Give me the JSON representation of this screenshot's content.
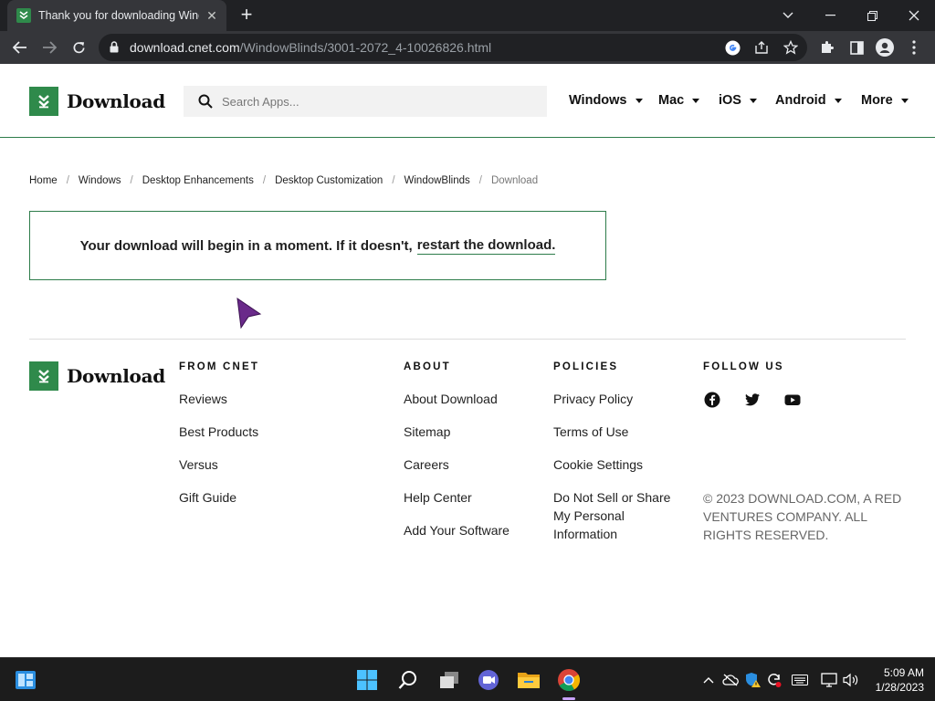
{
  "browser": {
    "tab_title": "Thank you for downloading WindowBlinds",
    "url_host": "download.cnet.com",
    "url_path": "/WindowBlinds/3001-2072_4-10026826.html"
  },
  "header": {
    "logo_text": "Download",
    "search_placeholder": "Search Apps...",
    "nav": [
      "Windows",
      "Mac",
      "iOS",
      "Android",
      "More"
    ]
  },
  "breadcrumb": [
    "Home",
    "Windows",
    "Desktop Enhancements",
    "Desktop Customization",
    "WindowBlinds",
    "Download"
  ],
  "message": {
    "text": "Your download will begin in a moment. If it doesn't,",
    "link": "restart the download."
  },
  "footer": {
    "logo_text": "Download",
    "from_cnet": {
      "heading": "FROM CNET",
      "links": [
        "Reviews",
        "Best Products",
        "Versus",
        "Gift Guide"
      ]
    },
    "about": {
      "heading": "ABOUT",
      "links": [
        "About Download",
        "Sitemap",
        "Careers",
        "Help Center",
        "Add Your Software"
      ]
    },
    "policies": {
      "heading": "POLICIES",
      "links": [
        "Privacy Policy",
        "Terms of Use",
        "Cookie Settings",
        "Do Not Sell or Share My Personal Information"
      ]
    },
    "follow": {
      "heading": "FOLLOW US",
      "icons": [
        "facebook-icon",
        "twitter-icon",
        "youtube-icon"
      ]
    },
    "copyright": "© 2023 DOWNLOAD.COM, A RED VENTURES COMPANY. ALL RIGHTS RESERVED."
  },
  "taskbar": {
    "time": "5:09 AM",
    "date": "1/28/2023"
  },
  "colors": {
    "brand_green": "#2f8a4b",
    "chrome_dark": "#202124",
    "chrome_toolbar": "#35363a"
  }
}
